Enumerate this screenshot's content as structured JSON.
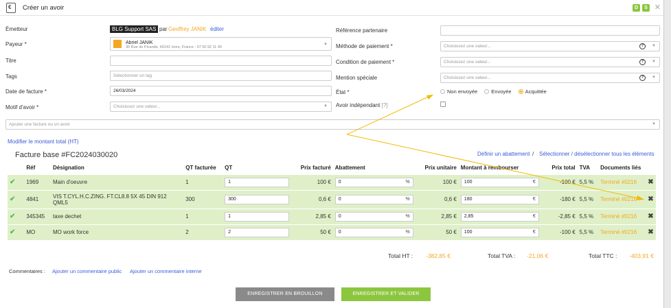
{
  "header": {
    "title": "Créer un avoir",
    "badges": [
      "D",
      "S"
    ],
    "close": "✕"
  },
  "form": {
    "emetteur": {
      "label": "Émetteur",
      "company": "BLG Support SAS",
      "par": "par",
      "user": "Geoffrey JANIK",
      "edit": "éditer"
    },
    "payeur": {
      "label": "Payeur *",
      "name": "Abriel JANIK",
      "address": "30 Rue de Picardie, 60141 Ivors, France - 07 50 92 11 40"
    },
    "titre": {
      "label": "Titre",
      "value": ""
    },
    "tags": {
      "label": "Tags",
      "placeholder": "Sélectionner un tag"
    },
    "date": {
      "label": "Date de facture *",
      "value": "26/03/2024"
    },
    "motif": {
      "label": "Motif d'avoir *",
      "placeholder": "Choisissez une valeur..."
    },
    "reference": {
      "label": "Référence partenaire",
      "value": ""
    },
    "methode": {
      "label": "Méthode de paiement *",
      "placeholder": "Choisissez une valeur..."
    },
    "condition": {
      "label": "Condition de paiement *",
      "placeholder": "Choisissez une valeur..."
    },
    "mention": {
      "label": "Mention spéciale",
      "placeholder": "Choisissez une valeur..."
    },
    "etat": {
      "label": "État *",
      "options": [
        "Non envoyée",
        "Envoyée",
        "Acquittée"
      ],
      "selected": "Acquittée"
    },
    "independant": {
      "label": "Avoir indépendant",
      "hint": "[?]"
    },
    "ajouter": {
      "placeholder": "Ajouter une facture ou un avoir"
    }
  },
  "modify_link": "Modifier le montant total (HT)",
  "invoice": {
    "title": "Facture base #FC2024030020",
    "action_abattement": "Définir un abattement",
    "separator": "/",
    "action_select": "Sélectionner / désélectionner tous les éléments",
    "columns": [
      "Réf",
      "Désignation",
      "QT facturée",
      "QT",
      "Prix facturé",
      "Abattement",
      "Prix unitaire",
      "Montant à rembourser",
      "Prix total",
      "TVA",
      "Documents liés"
    ],
    "rows": [
      {
        "ref": "1969",
        "designation": "Main d'oeuvre",
        "qt_facturee": "1",
        "qt": "1",
        "prix_facture": "100 €",
        "abattement": "0",
        "pct": "%",
        "prix_unitaire": "100 €",
        "montant": "100",
        "cur": "€",
        "prix_total": "-100 €",
        "tva": "5,5 %",
        "doc": "Terminé #0216"
      },
      {
        "ref": "4841",
        "designation": "VIS T.CYL.H.C.ZING. FT.CL8.8 5X 45 DIN 912 QML5",
        "qt_facturee": "300",
        "qt": "300",
        "prix_facture": "0,6 €",
        "abattement": "0",
        "pct": "%",
        "prix_unitaire": "0,6 €",
        "montant": "180",
        "cur": "€",
        "prix_total": "-180 €",
        "tva": "5,5 %",
        "doc": "Terminé #0216"
      },
      {
        "ref": "345345",
        "designation": "taxe dechet",
        "qt_facturee": "1",
        "qt": "1",
        "prix_facture": "2,85 €",
        "abattement": "0",
        "pct": "%",
        "prix_unitaire": "2,85 €",
        "montant": "2,85",
        "cur": "€",
        "prix_total": "-2,85 €",
        "tva": "5,5 %",
        "doc": "Terminé #0216"
      },
      {
        "ref": "MO",
        "designation": "MO work force",
        "qt_facturee": "2",
        "qt": "2",
        "prix_facture": "50 €",
        "abattement": "0",
        "pct": "%",
        "prix_unitaire": "50 €",
        "montant": "100",
        "cur": "€",
        "prix_total": "-100 €",
        "tva": "5,5 %",
        "doc": "Terminé #0216"
      }
    ]
  },
  "totals": {
    "ht_label": "Total HT :",
    "ht": "-382,85 €",
    "tva_label": "Total TVA :",
    "tva": "-21,06 €",
    "ttc_label": "Total TTC :",
    "ttc": "-403,91 €"
  },
  "comments": {
    "label": "Commentaires :",
    "public": "Ajouter un commentaire public",
    "internal": "Ajouter un commentaire interne"
  },
  "buttons": {
    "draft": "ENREGISTRER EN BROUILLON",
    "validate": "ENREGISTRER ET VALIDER"
  },
  "colors": {
    "accent": "#f5a623",
    "link": "#3a5bd8",
    "row_bg": "#dff0c8",
    "validate": "#8cc63f",
    "draft": "#8a8a8a"
  }
}
